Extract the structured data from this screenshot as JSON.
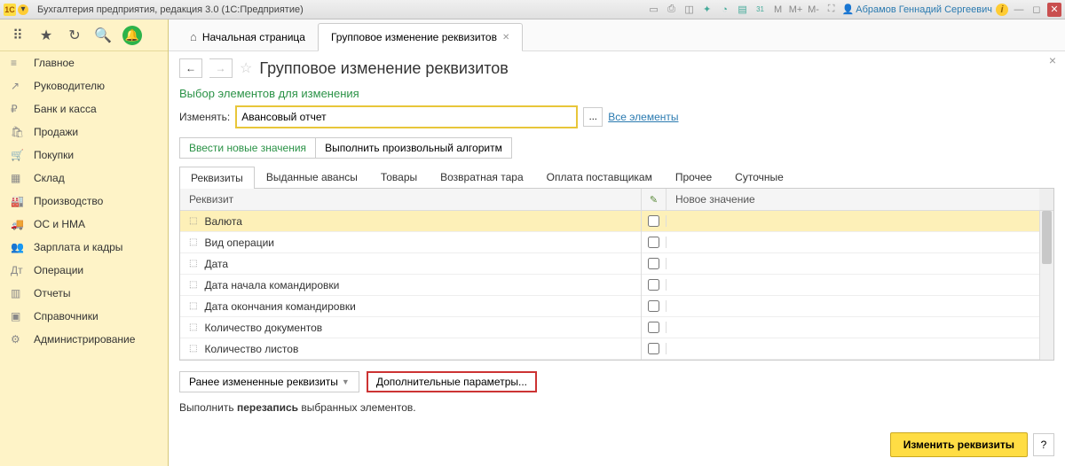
{
  "titlebar": {
    "app_title": "Бухгалтерия предприятия, редакция 3.0  (1С:Предприятие)",
    "user_name": "Абрамов Геннадий Сергеевич",
    "m_labels": [
      "М",
      "М+",
      "М-"
    ],
    "cal_badge": "31"
  },
  "sidebar": {
    "items": [
      {
        "icon": "≡",
        "label": "Главное"
      },
      {
        "icon": "↗",
        "label": "Руководителю"
      },
      {
        "icon": "₽",
        "label": "Банк и касса"
      },
      {
        "icon": "🛍",
        "label": "Продажи"
      },
      {
        "icon": "🛒",
        "label": "Покупки"
      },
      {
        "icon": "▦",
        "label": "Склад"
      },
      {
        "icon": "🏭",
        "label": "Производство"
      },
      {
        "icon": "🚚",
        "label": "ОС и НМА"
      },
      {
        "icon": "👥",
        "label": "Зарплата и кадры"
      },
      {
        "icon": "Дт",
        "label": "Операции"
      },
      {
        "icon": "▥",
        "label": "Отчеты"
      },
      {
        "icon": "▣",
        "label": "Справочники"
      },
      {
        "icon": "⚙",
        "label": "Администрирование"
      }
    ]
  },
  "tabs": {
    "home": "Начальная страница",
    "active": "Групповое изменение реквизитов"
  },
  "page": {
    "title": "Групповое изменение реквизитов",
    "section": "Выбор элементов для изменения",
    "change_label": "Изменять:",
    "change_value": "Авансовый отчет",
    "all_elements": "Все элементы",
    "mode1": "Ввести новые значения",
    "mode2": "Выполнить произвольный алгоритм",
    "subtabs": [
      "Реквизиты",
      "Выданные авансы",
      "Товары",
      "Возвратная тара",
      "Оплата поставщикам",
      "Прочее",
      "Суточные"
    ],
    "col_req": "Реквизит",
    "col_new": "Новое значение",
    "rows": [
      "Валюта",
      "Вид операции",
      "Дата",
      "Дата начала командировки",
      "Дата окончания командировки",
      "Количество документов",
      "Количество листов"
    ],
    "prev_btn": "Ранее измененные реквизиты",
    "extra_btn": "Дополнительные параметры...",
    "footer_pre": "Выполнить ",
    "footer_bold": "перезапись",
    "footer_post": " выбранных элементов.",
    "action": "Изменить реквизиты",
    "help": "?"
  }
}
